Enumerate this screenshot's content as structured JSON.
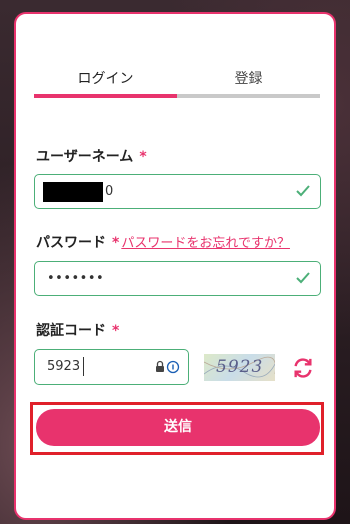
{
  "tabs": {
    "login": "ログイン",
    "register": "登録"
  },
  "username": {
    "label": "ユーザーネーム",
    "required": "*",
    "visible_suffix": "0"
  },
  "password": {
    "label": "パスワード",
    "required": "*",
    "forgot": "パスワードをお忘れですか？",
    "value": "•••••••"
  },
  "captcha": {
    "label": "認証コード",
    "required": "*",
    "value": "5923",
    "image_text": "5923"
  },
  "submit": {
    "label": "送信"
  },
  "icons": {
    "valid": "check-icon",
    "refresh": "refresh-icon",
    "lock": "lock-icon",
    "info": "info-icon"
  },
  "colors": {
    "accent": "#e8336d",
    "valid": "#4caf78",
    "highlight": "#e0202a"
  }
}
